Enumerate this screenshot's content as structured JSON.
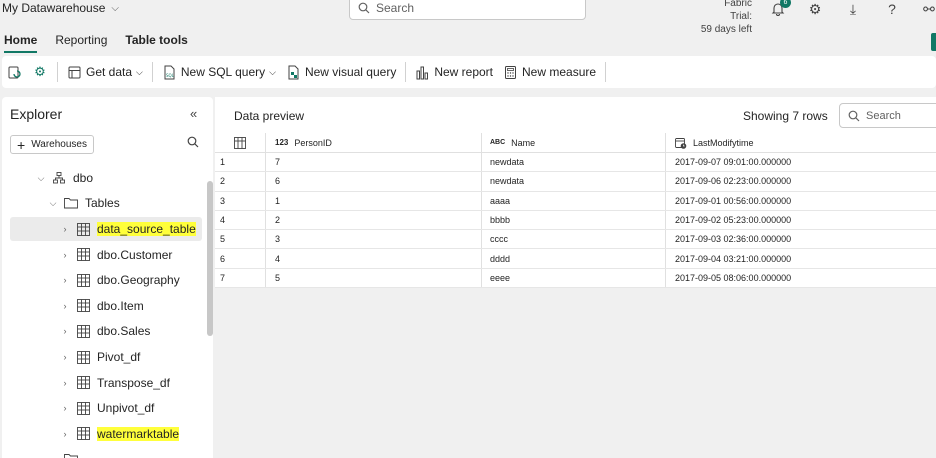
{
  "topbar": {
    "workspace": "My Datawarehouse",
    "search_placeholder": "Search",
    "trial_line1": "Fabric Trial:",
    "trial_line2": "59 days left",
    "notification_count": "6"
  },
  "tabs": [
    {
      "label": "Home"
    },
    {
      "label": "Reporting"
    },
    {
      "label": "Table tools"
    }
  ],
  "toolbar": {
    "get_data": "Get data",
    "new_sql_query": "New SQL query",
    "new_visual_query": "New visual query",
    "new_report": "New report",
    "new_measure": "New measure"
  },
  "explorer": {
    "title": "Explorer",
    "warehouses_button": "Warehouses",
    "schema": "dbo",
    "tables_folder": "Tables",
    "tables": [
      {
        "name": "data_source_table",
        "highlighted": true,
        "selected": true
      },
      {
        "name": "dbo.Customer"
      },
      {
        "name": "dbo.Geography"
      },
      {
        "name": "dbo.Item"
      },
      {
        "name": "dbo.Sales"
      },
      {
        "name": "Pivot_df"
      },
      {
        "name": "Transpose_df"
      },
      {
        "name": "Unpivot_df"
      },
      {
        "name": "watermarktable",
        "highlighted": true
      }
    ]
  },
  "preview": {
    "title": "Data preview",
    "row_count": "Showing 7 rows",
    "search_placeholder": "Search",
    "columns": [
      {
        "type": "123",
        "name": "PersonID"
      },
      {
        "type": "ABC",
        "name": "Name"
      },
      {
        "type": "clock",
        "name": "LastModifytime"
      }
    ],
    "rows": [
      {
        "n": "1",
        "id": "7",
        "name": "newdata",
        "time": "2017-09-07 09:01:00.000000"
      },
      {
        "n": "2",
        "id": "6",
        "name": "newdata",
        "time": "2017-09-06 02:23:00.000000"
      },
      {
        "n": "3",
        "id": "1",
        "name": "aaaa",
        "time": "2017-09-01 00:56:00.000000"
      },
      {
        "n": "4",
        "id": "2",
        "name": "bbbb",
        "time": "2017-09-02 05:23:00.000000"
      },
      {
        "n": "5",
        "id": "3",
        "name": "cccc",
        "time": "2017-09-03 02:36:00.000000"
      },
      {
        "n": "6",
        "id": "4",
        "name": "dddd",
        "time": "2017-09-04 03:21:00.000000"
      },
      {
        "n": "7",
        "id": "5",
        "name": "eeee",
        "time": "2017-09-05 08:06:00.000000"
      }
    ]
  },
  "colors": {
    "accent": "#117865",
    "highlight": "#ffff3b"
  }
}
